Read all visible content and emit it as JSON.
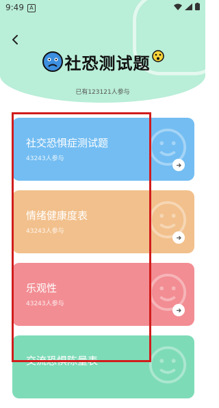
{
  "status_bar": {
    "time": "9:49",
    "notif": "A"
  },
  "header": {
    "title": "社恐测试题",
    "subtitle": "已有123121人参与"
  },
  "colors": {
    "header": "#b9eed8",
    "blue": "#73bdf2",
    "orange": "#f2c08c",
    "pink": "#f28d93",
    "green": "#7edbb8",
    "highlight": "#d11c1c"
  },
  "tests": [
    {
      "name": "社交恐惧症测试题",
      "count": "43243人参与",
      "color": "#73bdf2"
    },
    {
      "name": "情绪健康度表",
      "count": "43243人参与",
      "color": "#f2c08c"
    },
    {
      "name": "乐观性",
      "count": "43243人参与",
      "color": "#f28d93"
    },
    {
      "name": "交流恐惧陈量表",
      "count": "",
      "color": "#7edbb8"
    }
  ]
}
